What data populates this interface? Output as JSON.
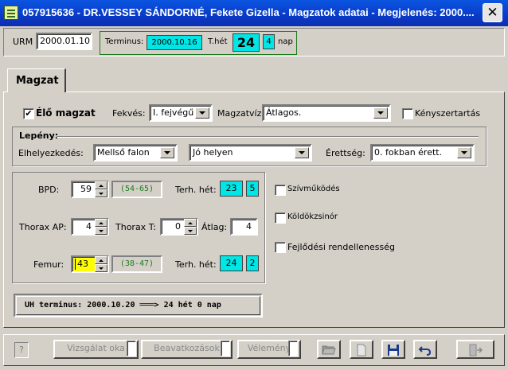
{
  "window": {
    "title": "057915636 - DR.VESSEY SÁNDORNÉ, Fekete Gizella - Magzatok adatai - Megjelenés: 2000....",
    "close_glyph": "✕"
  },
  "header": {
    "urm_label": "URM",
    "urm_value": "2000.01.10",
    "terminus_label": "Terminus:",
    "terminus_value": "2000.10.16",
    "thet_label": "T.hét",
    "thet_weeks": "24",
    "thet_days": "4",
    "nap_label": "nap"
  },
  "tab": {
    "label": "Magzat"
  },
  "row1": {
    "elo_magzat_label": "Élő magzat",
    "elo_magzat_checked": "✔",
    "fekves_label": "Fekvés:",
    "fekves_value": "I. fejvégű",
    "magzatviz_label": "Magzatvíz:",
    "magzatviz_value": "Átlagos.",
    "kenyszer_label": "Kényszertartás"
  },
  "lepeny": {
    "title": "Lepény:",
    "elhelyezkedes_label": "Elhelyezkedés:",
    "elhelyezkedes_value": "Mellső falon",
    "helyzet_value": "Jó helyen",
    "erettseg_label": "Érettség:",
    "erettseg_value": "0. fokban érett."
  },
  "measure": {
    "bpd_label": "BPD:",
    "bpd_value": "59",
    "bpd_range": "(54-65)",
    "terh_het_label": "Terh. hét:",
    "bpd_weeks": "23",
    "bpd_days": "5",
    "thorax_ap_label": "Thorax AP:",
    "thorax_ap_value": "4",
    "thorax_t_label": "Thorax T:",
    "thorax_t_value": "0",
    "atlag_label": "Átlag:",
    "atlag_value": "4",
    "femur_label": "Femur:",
    "femur_value": "43",
    "femur_range": "(38-47)",
    "femur_weeks": "24",
    "femur_days": "2"
  },
  "checks": {
    "szivmukodes": "Szívműködés",
    "koldokzsinor": "Köldökzsinór",
    "fejlodesi": "Fejlődési rendellenesség"
  },
  "uh_terminus": "UH terminus: 2000.10.20 ═══> 24 hét 0 nap",
  "toolbar": {
    "help_label": "?",
    "vizsgalat_label": "Vizsgálat oka",
    "beavatkozasok_label": "Beavatkozások",
    "velemeny_label": "Vélemény"
  }
}
